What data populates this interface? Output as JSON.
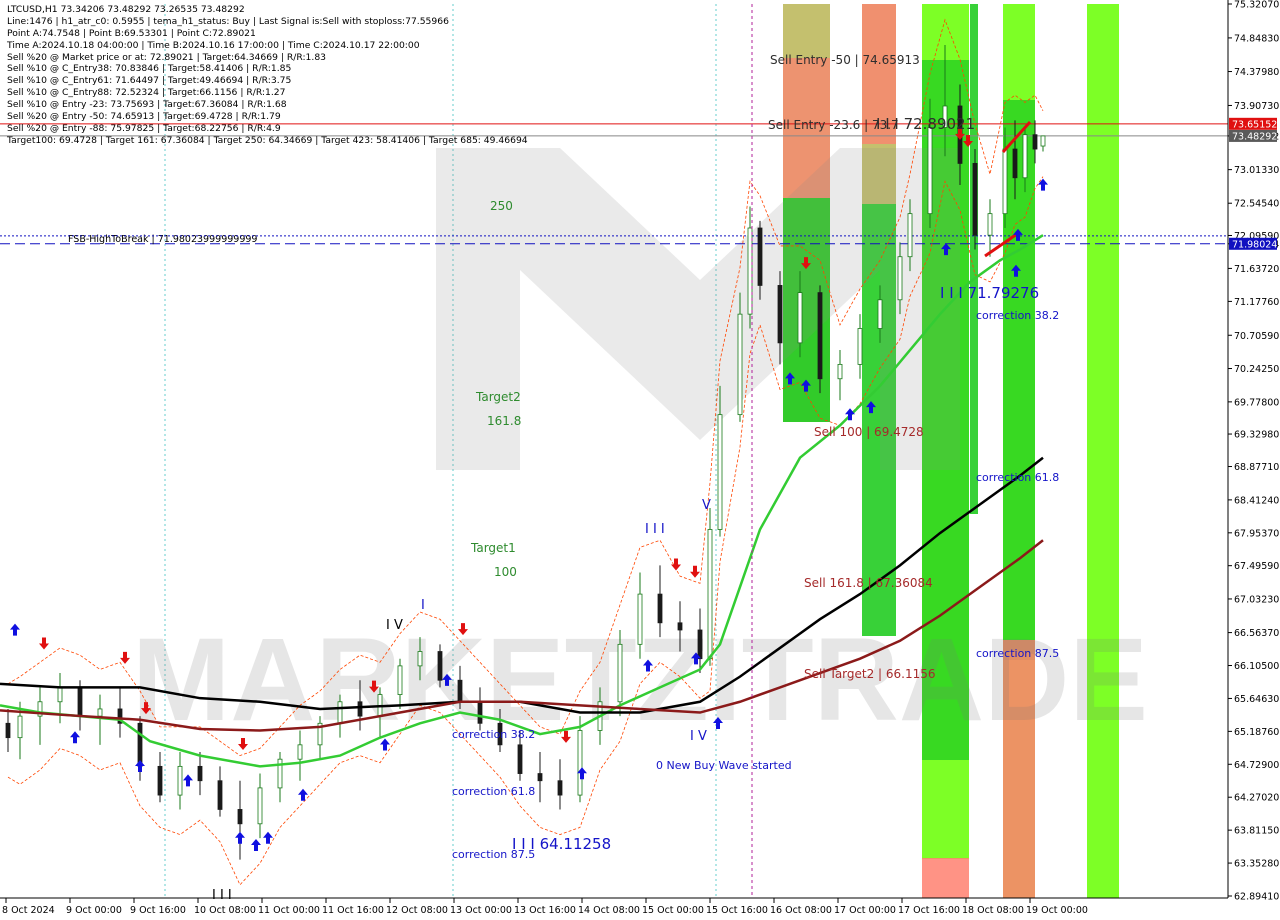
{
  "header": {
    "lines": [
      "LTCUSD,H1  73.34206 73.48292 73.26535 73.48292",
      "Line:1476 | h1_atr_c0: 0.5955 | tema_h1_status: Buy | Last Signal is:Sell with stoploss:77.55966",
      "Point A:74.7548 | Point B:69.53301 | Point C:72.89021",
      "Time A:2024.10.18 04:00:00 | Time B:2024.10.16 17:00:00 | Time C:2024.10.17 22:00:00",
      "Sell %20 @ Market price or at: 72.89021 | Target:64.34669 | R/R:1.83",
      "Sell %10 @ C_Entry38: 70.83846 | Target:58.41406 | R/R:1.85",
      "Sell %10 @ C_Entry61: 71.64497 | Target:49.46694 | R/R:3.75",
      "Sell %10 @ C_Entry88: 72.52324 | Target:66.1156 | R/R:1.27",
      "Sell %10 @ Entry -23: 73.75693 | Target:67.36084 | R/R:1.68",
      "Sell %20 @ Entry -50: 74.65913 | Target:69.4728 | R/R:1.79",
      "Sell %20 @ Entry -88: 75.97825 | Target:68.22756 | R/R:4.9",
      "Target100: 69.4728 | Target 161: 67.36084 | Target 250: 64.34669 | Target 423: 58.41406 | Target 685: 49.46694"
    ]
  },
  "colors": {
    "background": "#ffffff",
    "bull_candle": "#1a7a1a",
    "bear_candle": "#1a1a1a",
    "ma_fast": "#33cc33",
    "ma_mid": "#000000",
    "ma_slow": "#8b1a1a",
    "envelope": "#ff4500",
    "zone_green": "#22cc22",
    "zone_lime": "#66ff00",
    "zone_salmon": "#ff8070",
    "zone_olive": "#b5b04a",
    "label_blue": "#1414c8",
    "label_green": "#2e8b2e",
    "label_brown": "#a52a2a",
    "price_tag_red": "#e01010",
    "price_tag_blue": "#1010c0"
  },
  "chart_data": {
    "type": "candlestick",
    "symbol": "LTCUSD",
    "timeframe": "H1",
    "ohlc_last": {
      "open": 73.34206,
      "high": 73.48292,
      "low": 73.26535,
      "close": 73.48292
    },
    "ylim": [
      62.8941,
      75.3207
    ],
    "y_ticks": [
      75.3207,
      74.8483,
      74.3798,
      73.9073,
      73.4829,
      73.0133,
      72.5454,
      72.0959,
      71.9802,
      71.6372,
      71.1776,
      70.7059,
      70.2425,
      69.778,
      69.3298,
      68.8771,
      68.4124,
      67.9537,
      67.4959,
      67.0323,
      66.5637,
      66.105,
      65.6463,
      65.1876,
      64.729,
      64.2702,
      63.8115,
      63.3528,
      62.8941
    ],
    "y_tick_labels": [
      "75.32070",
      "74.84830",
      "74.37980",
      "73.90730",
      "73.48292",
      "73.01330",
      "72.54540",
      "72.09590",
      "71.98024",
      "71.63720",
      "71.17760",
      "70.70590",
      "70.24250",
      "69.77800",
      "69.32980",
      "68.87710",
      "68.41240",
      "67.95370",
      "67.49590",
      "67.03230",
      "66.56370",
      "66.10500",
      "65.64630",
      "65.18760",
      "64.72900",
      "64.27020",
      "63.81150",
      "63.35280",
      "62.89410"
    ],
    "x_tick_labels": [
      "8 Oct 2024",
      "9 Oct 00:00",
      "9 Oct 16:00",
      "10 Oct 08:00",
      "11 Oct 00:00",
      "11 Oct 16:00",
      "12 Oct 08:00",
      "13 Oct 00:00",
      "13 Oct 16:00",
      "14 Oct 08:00",
      "15 Oct 00:00",
      "15 Oct 16:00",
      "16 Oct 08:00",
      "17 Oct 00:00",
      "17 Oct 16:00",
      "18 Oct 08:00",
      "19 Oct 00:00"
    ],
    "price_tags": [
      {
        "value": 73.65152,
        "label": "73.65152",
        "style": "red"
      },
      {
        "value": 73.48292,
        "label": "73.48292",
        "style": "gray"
      },
      {
        "value": 71.98024,
        "label": "71.98024",
        "style": "blue"
      }
    ],
    "level_lines": [
      {
        "name": "FSB-HighToBreak",
        "value": 71.98024,
        "label": "FSB-HighToBreak | 71.98023999999999",
        "style": "dashed-blue"
      },
      {
        "name": "entry-level",
        "value": 72.09,
        "style": "dotted-blue"
      },
      {
        "name": "sell-stop-line",
        "value": 73.65152,
        "style": "solid-red"
      }
    ],
    "series": [
      {
        "name": "ma_fast",
        "points": [
          [
            0,
            65.55
          ],
          [
            40,
            65.45
          ],
          [
            80,
            65.4
          ],
          [
            120,
            65.35
          ],
          [
            150,
            65.05
          ],
          [
            200,
            64.85
          ],
          [
            260,
            64.7
          ],
          [
            300,
            64.75
          ],
          [
            340,
            64.85
          ],
          [
            380,
            65.1
          ],
          [
            420,
            65.3
          ],
          [
            460,
            65.45
          ],
          [
            500,
            65.35
          ],
          [
            540,
            65.15
          ],
          [
            580,
            65.25
          ],
          [
            620,
            65.55
          ],
          [
            660,
            65.8
          ],
          [
            700,
            66.05
          ],
          [
            720,
            66.4
          ],
          [
            740,
            67.2
          ],
          [
            760,
            68.0
          ],
          [
            780,
            68.5
          ],
          [
            800,
            69.0
          ],
          [
            840,
            69.45
          ],
          [
            880,
            70.0
          ],
          [
            910,
            70.5
          ],
          [
            940,
            71.0
          ],
          [
            970,
            71.45
          ],
          [
            1000,
            71.75
          ],
          [
            1020,
            71.9
          ],
          [
            1043,
            72.1
          ]
        ]
      },
      {
        "name": "ma_mid",
        "points": [
          [
            0,
            65.85
          ],
          [
            60,
            65.8
          ],
          [
            140,
            65.8
          ],
          [
            200,
            65.65
          ],
          [
            260,
            65.6
          ],
          [
            320,
            65.5
          ],
          [
            400,
            65.55
          ],
          [
            460,
            65.6
          ],
          [
            520,
            65.6
          ],
          [
            580,
            65.45
          ],
          [
            640,
            65.45
          ],
          [
            700,
            65.6
          ],
          [
            740,
            65.95
          ],
          [
            780,
            66.35
          ],
          [
            820,
            66.75
          ],
          [
            860,
            67.1
          ],
          [
            900,
            67.5
          ],
          [
            940,
            67.95
          ],
          [
            980,
            68.35
          ],
          [
            1020,
            68.75
          ],
          [
            1043,
            69.0
          ]
        ]
      },
      {
        "name": "ma_slow",
        "points": [
          [
            0,
            65.48
          ],
          [
            60,
            65.42
          ],
          [
            140,
            65.35
          ],
          [
            200,
            65.22
          ],
          [
            260,
            65.2
          ],
          [
            320,
            65.25
          ],
          [
            400,
            65.45
          ],
          [
            460,
            65.6
          ],
          [
            520,
            65.6
          ],
          [
            580,
            65.55
          ],
          [
            640,
            65.5
          ],
          [
            700,
            65.45
          ],
          [
            740,
            65.6
          ],
          [
            780,
            65.8
          ],
          [
            820,
            66.0
          ],
          [
            860,
            66.2
          ],
          [
            900,
            66.45
          ],
          [
            940,
            66.8
          ],
          [
            980,
            67.2
          ],
          [
            1020,
            67.6
          ],
          [
            1043,
            67.85
          ]
        ]
      }
    ],
    "candles_sample": [
      [
        8,
        65.3,
        65.5,
        64.9,
        65.1
      ],
      [
        20,
        65.1,
        65.6,
        64.8,
        65.4
      ],
      [
        40,
        65.4,
        65.8,
        65.0,
        65.6
      ],
      [
        60,
        65.6,
        66.0,
        65.3,
        65.8
      ],
      [
        80,
        65.8,
        65.9,
        65.2,
        65.4
      ],
      [
        100,
        65.4,
        65.7,
        65.0,
        65.5
      ],
      [
        120,
        65.5,
        65.8,
        65.1,
        65.3
      ],
      [
        140,
        65.3,
        65.4,
        64.5,
        64.7
      ],
      [
        160,
        64.7,
        64.9,
        64.2,
        64.3
      ],
      [
        180,
        64.3,
        64.9,
        64.1,
        64.7
      ],
      [
        200,
        64.7,
        64.9,
        64.3,
        64.5
      ],
      [
        220,
        64.5,
        64.7,
        64.0,
        64.1
      ],
      [
        240,
        64.1,
        64.5,
        63.4,
        63.9
      ],
      [
        260,
        63.9,
        64.6,
        63.7,
        64.4
      ],
      [
        280,
        64.4,
        64.9,
        64.2,
        64.8
      ],
      [
        300,
        64.8,
        65.2,
        64.5,
        65.0
      ],
      [
        320,
        65.0,
        65.4,
        64.8,
        65.3
      ],
      [
        340,
        65.3,
        65.7,
        65.1,
        65.6
      ],
      [
        360,
        65.6,
        65.9,
        65.2,
        65.4
      ],
      [
        380,
        65.4,
        65.8,
        65.1,
        65.7
      ],
      [
        400,
        65.7,
        66.2,
        65.5,
        66.1
      ],
      [
        420,
        66.1,
        66.5,
        65.9,
        66.3
      ],
      [
        440,
        66.3,
        66.4,
        65.8,
        65.9
      ],
      [
        460,
        65.9,
        66.1,
        65.5,
        65.6
      ],
      [
        480,
        65.6,
        65.8,
        65.2,
        65.3
      ],
      [
        500,
        65.3,
        65.5,
        64.9,
        65.0
      ],
      [
        520,
        65.0,
        65.2,
        64.5,
        64.6
      ],
      [
        540,
        64.6,
        64.9,
        64.2,
        64.5
      ],
      [
        560,
        64.5,
        64.8,
        64.1,
        64.3
      ],
      [
        580,
        64.3,
        65.4,
        64.2,
        65.2
      ],
      [
        600,
        65.2,
        65.8,
        65.0,
        65.6
      ],
      [
        620,
        65.6,
        66.6,
        65.4,
        66.4
      ],
      [
        640,
        66.4,
        67.4,
        66.2,
        67.1
      ],
      [
        660,
        67.1,
        67.5,
        66.5,
        66.7
      ],
      [
        680,
        66.7,
        67.0,
        66.3,
        66.6
      ],
      [
        700,
        66.6,
        66.9,
        66.0,
        66.2
      ],
      [
        710,
        66.2,
        68.3,
        66.1,
        68.0
      ],
      [
        720,
        68.0,
        70.0,
        67.9,
        69.6
      ],
      [
        740,
        69.6,
        71.3,
        69.5,
        71.0
      ],
      [
        750,
        71.0,
        72.5,
        70.8,
        72.2
      ],
      [
        760,
        72.2,
        72.3,
        71.2,
        71.4
      ],
      [
        780,
        71.4,
        71.6,
        70.3,
        70.6
      ],
      [
        800,
        70.6,
        71.6,
        70.4,
        71.3
      ],
      [
        820,
        71.3,
        71.4,
        69.9,
        70.1
      ],
      [
        840,
        70.1,
        70.5,
        69.8,
        70.3
      ],
      [
        860,
        70.3,
        71.0,
        70.1,
        70.8
      ],
      [
        880,
        70.8,
        71.4,
        70.6,
        71.2
      ],
      [
        900,
        71.2,
        72.0,
        71.0,
        71.8
      ],
      [
        910,
        71.8,
        72.6,
        71.6,
        72.4
      ],
      [
        930,
        72.4,
        74.0,
        72.2,
        73.6
      ],
      [
        945,
        73.6,
        74.75,
        73.2,
        73.9
      ],
      [
        960,
        73.9,
        74.2,
        72.8,
        73.1
      ],
      [
        975,
        73.1,
        73.3,
        71.9,
        72.1
      ],
      [
        990,
        72.1,
        72.6,
        71.8,
        72.4
      ],
      [
        1005,
        72.4,
        73.6,
        72.2,
        73.3
      ],
      [
        1015,
        73.3,
        73.7,
        72.6,
        72.9
      ],
      [
        1025,
        72.9,
        73.6,
        72.7,
        73.5
      ],
      [
        1035,
        73.5,
        73.7,
        73.1,
        73.3
      ],
      [
        1043,
        73.34206,
        73.48292,
        73.26535,
        73.48292
      ]
    ]
  },
  "annotations": {
    "sell_entry_50": "Sell Entry -50 | 74.65913",
    "sell_entry_23": "Sell Entry -23.6 | 73.7",
    "point_c_value": "I I I 72.89021",
    "label_250": "250",
    "target2": "Target2",
    "fib_161": "161.8",
    "target1": "Target1",
    "fib_100": "100",
    "sell_100": "Sell 100 | 69.4728",
    "sell_161": "Sell 161.8 | 67.36084",
    "sell_target2": "Sell Target2 | 66.1156",
    "point_b_value": "I I I 71.79276",
    "correction_382_r": "correction 38.2",
    "correction_618_r": "correction 61.8",
    "correction_875_r": "correction 87.5",
    "correction_382_l": "correction 38.2",
    "correction_618_l": "correction 61.8",
    "correction_875_l": "correction 87.5",
    "low_value": "I I I 64.11258",
    "new_wave": "0 New Buy Wave started",
    "wave_iii": "I I I",
    "wave_iv": "I V",
    "wave_v": "V",
    "wave_iv_left": "I V",
    "wave_i": "I",
    "wave_iii_bottom": "I I I",
    "watermark": "MARKETZITRADE"
  }
}
